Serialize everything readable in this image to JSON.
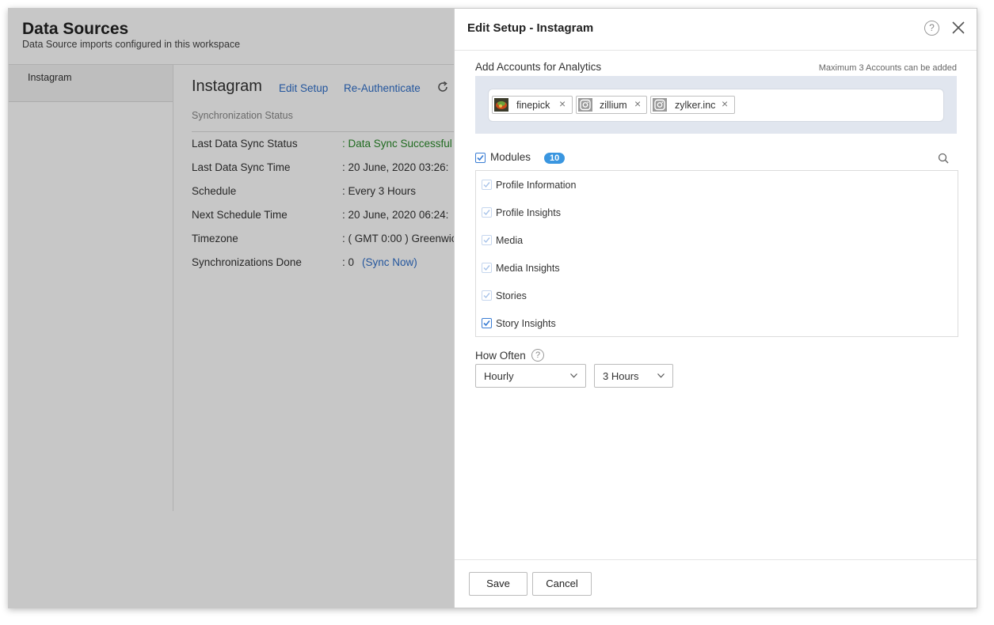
{
  "background": {
    "title": "Data Sources",
    "subtitle": "Data Source imports configured in this workspace",
    "sidebar_item": "Instagram",
    "datasource_title": "Instagram",
    "edit_setup_link": "Edit Setup",
    "reauth_link": "Re-Authenticate",
    "sync_status_label": "Synchronization Status",
    "rows": [
      {
        "key": "Last Data Sync Status",
        "value": ": Data Sync Successful"
      },
      {
        "key": "Last Data Sync Time",
        "value": ": 20 June, 2020 03:26:"
      },
      {
        "key": "Schedule",
        "value": ": Every 3 Hours"
      },
      {
        "key": "Next Schedule Time",
        "value": ": 20 June, 2020 06:24:"
      },
      {
        "key": "Timezone",
        "value": ": ( GMT 0:00 ) Greenwic"
      },
      {
        "key": "Synchronizations Done",
        "value": ": 0",
        "link": "(Sync Now)"
      }
    ],
    "colors": {
      "success": "#2a8a2a",
      "link": "#2f6fc9"
    }
  },
  "panel": {
    "title": "Edit Setup - Instagram",
    "help_glyph": "?",
    "accounts": {
      "label": "Add Accounts for Analytics",
      "max_note": "Maximum 3 Accounts can be added",
      "chips": [
        {
          "name": "finepick",
          "icon": "profile-picture-icon"
        },
        {
          "name": "zillium",
          "icon": "instagram-icon"
        },
        {
          "name": "zylker.inc",
          "icon": "instagram-icon"
        }
      ]
    },
    "modules": {
      "label": "Modules",
      "count": "10",
      "items": [
        {
          "label": "Profile Information",
          "checked": true
        },
        {
          "label": "Profile Insights",
          "checked": true
        },
        {
          "label": "Media",
          "checked": true
        },
        {
          "label": "Media Insights",
          "checked": true
        },
        {
          "label": "Stories",
          "checked": true
        },
        {
          "label": "Story Insights",
          "checked": true
        }
      ]
    },
    "how_often": {
      "label": "How Often",
      "frequency": "Hourly",
      "interval": "3 Hours"
    },
    "footer": {
      "save_label": "Save",
      "cancel_label": "Cancel"
    },
    "colors": {
      "accent": "#3a7dd4",
      "badge": "#3a96e0",
      "account_box": "#e1e6ef"
    }
  }
}
